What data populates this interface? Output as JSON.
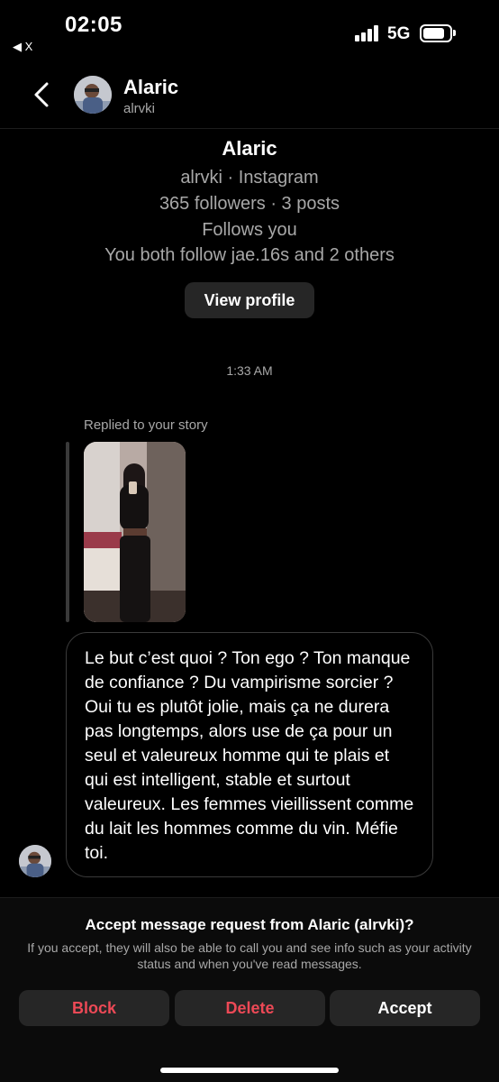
{
  "status_bar": {
    "time": "02:05",
    "back_app": "◀ X",
    "network": "5G",
    "icons": [
      "signal-icon",
      "battery-icon"
    ]
  },
  "header": {
    "name": "Alaric",
    "username": "alrvki",
    "icons": [
      "back-chevron-icon",
      "avatar"
    ]
  },
  "profile_card": {
    "name": "Alaric",
    "platform_line": "alrvki · Instagram",
    "stats_line": "365 followers · 3 posts",
    "follows_line": "Follows you",
    "mutual_line": "You both follow jae.16s and 2 others",
    "view_profile_label": "View profile"
  },
  "thread": {
    "timestamp": "1:33 AM",
    "replied_label": "Replied to your story",
    "message": "Le but c’est quoi ? Ton ego ? Ton manque de confiance ? Du vampirisme sorcier ? Oui tu es plutôt jolie, mais ça ne durera pas longtemps, alors use de ça pour un seul et valeureux homme qui te plais et qui est intelligent, stable et surtout valeureux. Les femmes vieillissent comme du lait les hommes comme du vin. Méfie toi."
  },
  "request": {
    "title": "Accept message request from Alaric (alrvki)?",
    "description": "If you accept, they will also be able to call you and see info such as your activity status and when you've read messages.",
    "block_label": "Block",
    "delete_label": "Delete",
    "accept_label": "Accept"
  },
  "colors": {
    "background": "#000000",
    "secondary_text": "#a8a8a8",
    "button_bg": "#262626",
    "destructive": "#ed4956"
  }
}
